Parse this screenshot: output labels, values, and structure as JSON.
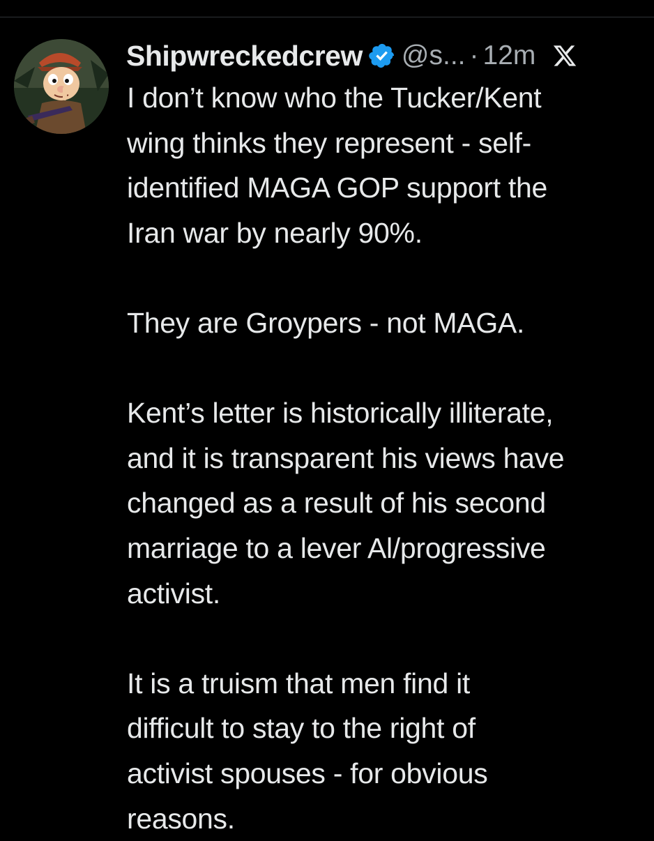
{
  "post": {
    "display_name": "Shipwreckedcrew",
    "handle": "@s...",
    "separator": "·",
    "time": "12m",
    "verified": true,
    "avatar_icon": "cartoon-hunter-avatar",
    "platform_icon": "x-logo-icon",
    "paragraphs": [
      "I don’t know who the Tucker/Kent\nwing thinks they represent - self-\nidentified MAGA GOP support the\nIran war by nearly 90%.",
      "They are Groypers - not MAGA.",
      "Kent’s letter is historically illiterate,\nand it is transparent his views have\nchanged as a result of his second\nmarriage to a lever Al/progressive\nactivist.",
      "It is a truism that men find it\ndifficult to stay to the right of\nactivist spouses - for obvious\nreasons."
    ]
  },
  "colors": {
    "background": "#000000",
    "text_primary": "#e7e9ea",
    "text_secondary": "#a8aeb3",
    "verified_blue": "#1d9bf0",
    "divider": "#2f3336"
  }
}
